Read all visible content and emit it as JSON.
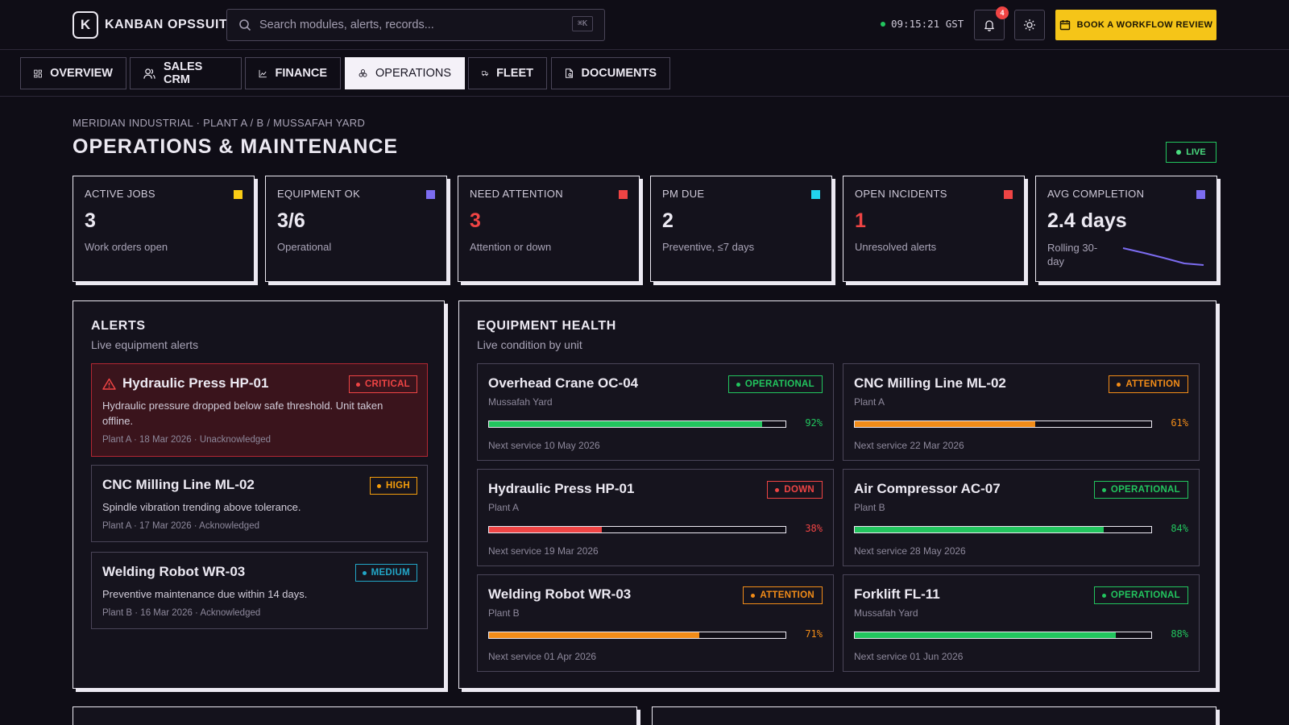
{
  "app": {
    "logo_mark": "K",
    "name": "KANBAN OPSSUITE",
    "search_placeholder": "Search modules, alerts, records...",
    "search_shortcut": "⌘K",
    "clock": "09:15:21 GST",
    "notification_count": "4",
    "cta_label": "BOOK A WORKFLOW REVIEW"
  },
  "tabs": [
    {
      "label": "OVERVIEW",
      "icon": "grid-icon",
      "active": false
    },
    {
      "label": "SALES CRM",
      "icon": "users-icon",
      "active": false
    },
    {
      "label": "FINANCE",
      "icon": "chart-line-icon",
      "active": false
    },
    {
      "label": "OPERATIONS",
      "icon": "cogs-icon",
      "active": true
    },
    {
      "label": "FLEET",
      "icon": "truck-icon",
      "active": false
    },
    {
      "label": "DOCUMENTS",
      "icon": "document-icon",
      "active": false
    }
  ],
  "header": {
    "breadcrumb": "MERIDIAN INDUSTRIAL · PLANT A / B / MUSSAFAH YARD",
    "title": "OPERATIONS & MAINTENANCE",
    "live_label": "LIVE"
  },
  "kpis": [
    {
      "label": "ACTIVE JOBS",
      "value": "3",
      "sub": "Work orders open",
      "color": "#facc15",
      "value_color": "#ece9f2"
    },
    {
      "label": "EQUIPMENT OK",
      "value": "3/6",
      "sub": "Operational",
      "color": "#7c6cf0",
      "value_color": "#ece9f2"
    },
    {
      "label": "NEED ATTENTION",
      "value": "3",
      "sub": "Attention or down",
      "color": "#ef4444",
      "value_color": "#ef4444"
    },
    {
      "label": "PM DUE",
      "value": "2",
      "sub": "Preventive, ≤7 days",
      "color": "#22d3ee",
      "value_color": "#ece9f2"
    },
    {
      "label": "OPEN INCIDENTS",
      "value": "1",
      "sub": "Unresolved alerts",
      "color": "#ef4444",
      "value_color": "#ef4444"
    },
    {
      "label": "AVG COMPLETION",
      "value": "2.4 days",
      "sub": "Rolling 30-day",
      "color": "#7c6cf0",
      "value_color": "#ece9f2"
    }
  ],
  "alerts_panel": {
    "title": "ALERTS",
    "subtitle": "Live equipment alerts",
    "items": [
      {
        "title": "Hydraulic Press HP-01",
        "severity": "CRITICAL",
        "desc": "Hydraulic pressure dropped below safe threshold. Unit taken offline.",
        "meta": "Plant A · 18 Mar 2026 · Unacknowledged",
        "color": "#ef4444"
      },
      {
        "title": "CNC Milling Line ML-02",
        "severity": "HIGH",
        "desc": "Spindle vibration trending above tolerance.",
        "meta": "Plant A · 17 Mar 2026 · Acknowledged",
        "color": "#f59e0b"
      },
      {
        "title": "Welding Robot WR-03",
        "severity": "MEDIUM",
        "desc": "Preventive maintenance due within 14 days.",
        "meta": "Plant B · 16 Mar 2026 · Acknowledged",
        "color": "#22a6c7"
      }
    ]
  },
  "equipment_panel": {
    "title": "EQUIPMENT HEALTH",
    "subtitle": "Live condition by unit",
    "items": [
      {
        "name": "Overhead Crane OC-04",
        "location": "Mussafah Yard",
        "status": "OPERATIONAL",
        "health": 92,
        "health_label": "92%",
        "next": "Next service 10 May 2026",
        "color": "#22c55e"
      },
      {
        "name": "CNC Milling Line ML-02",
        "location": "Plant A",
        "status": "ATTENTION",
        "health": 61,
        "health_label": "61%",
        "next": "Next service 22 Mar 2026",
        "color": "#f28c18"
      },
      {
        "name": "Hydraulic Press HP-01",
        "location": "Plant A",
        "status": "DOWN",
        "health": 38,
        "health_label": "38%",
        "next": "Next service 19 Mar 2026",
        "color": "#ef4444"
      },
      {
        "name": "Air Compressor AC-07",
        "location": "Plant B",
        "status": "OPERATIONAL",
        "health": 84,
        "health_label": "84%",
        "next": "Next service 28 May 2026",
        "color": "#22c55e"
      },
      {
        "name": "Welding Robot WR-03",
        "location": "Plant B",
        "status": "ATTENTION",
        "health": 71,
        "health_label": "71%",
        "next": "Next service 01 Apr 2026",
        "color": "#f28c18"
      },
      {
        "name": "Forklift FL-11",
        "location": "Mussafah Yard",
        "status": "OPERATIONAL",
        "health": 88,
        "health_label": "88%",
        "next": "Next service 01 Jun 2026",
        "color": "#22c55e"
      }
    ]
  }
}
